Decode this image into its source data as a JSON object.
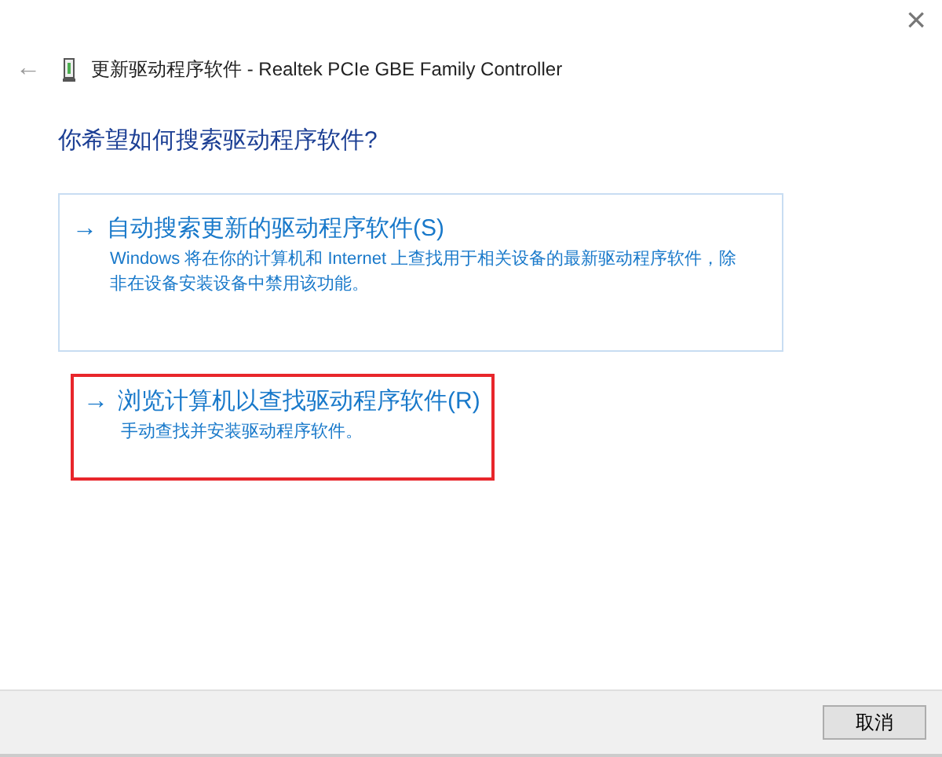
{
  "window": {
    "close": "×"
  },
  "header": {
    "back": "←",
    "title": "更新驱动程序软件 - Realtek PCIe GBE Family Controller"
  },
  "question": "你希望如何搜索驱动程序软件?",
  "options": [
    {
      "arrow": "→",
      "title": "自动搜索更新的驱动程序软件(S)",
      "description": "Windows 将在你的计算机和 Internet 上查找用于相关设备的最新驱动程序软件，除非在设备安装设备中禁用该功能。",
      "selected": true,
      "highlighted": false
    },
    {
      "arrow": "→",
      "title": "浏览计算机以查找驱动程序软件(R)",
      "description": "手动查找并安装驱动程序软件。",
      "selected": false,
      "highlighted": true
    }
  ],
  "buttons": [
    "取消"
  ]
}
